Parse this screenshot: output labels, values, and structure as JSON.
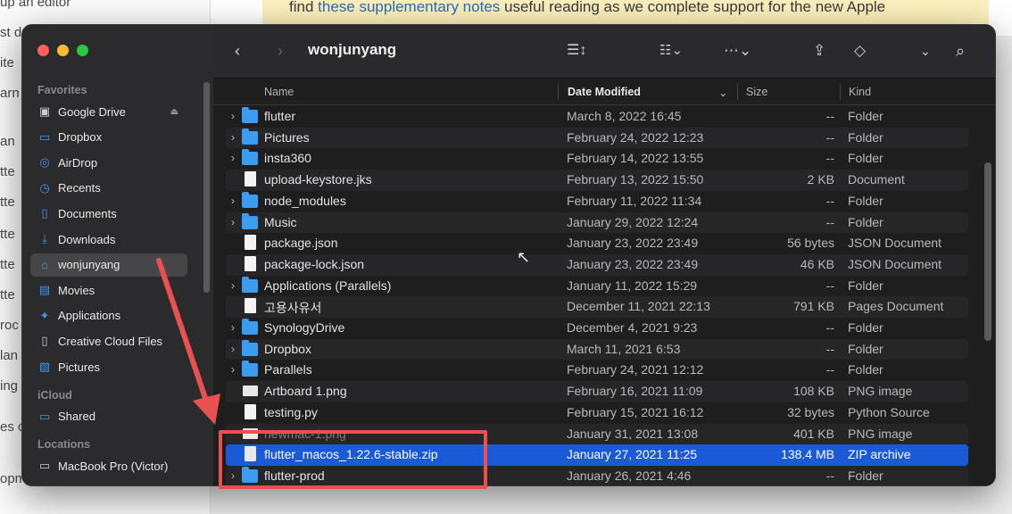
{
  "background": {
    "left_fragments": [
      "up an editor",
      "st d",
      "ite",
      "arn",
      "an",
      "tte",
      "tte",
      "tte",
      "tte",
      "tte",
      "roc",
      "lan",
      "ing",
      "es c",
      "opm"
    ],
    "note_prefix": "find ",
    "note_link": "these supplementary notes",
    "note_suffix": " useful reading as we complete support for the new Apple"
  },
  "window": {
    "title": "wonjunyang",
    "sidebar": {
      "sections": [
        {
          "label": "Favorites",
          "items": [
            {
              "label": "Google Drive",
              "icon": "drive-icon"
            },
            {
              "label": "Dropbox",
              "icon": "folder-icon"
            },
            {
              "label": "AirDrop",
              "icon": "airdrop-icon"
            },
            {
              "label": "Recents",
              "icon": "clock-icon"
            },
            {
              "label": "Documents",
              "icon": "document-icon"
            },
            {
              "label": "Downloads",
              "icon": "download-icon"
            },
            {
              "label": "wonjunyang",
              "icon": "home-icon",
              "selected": true
            },
            {
              "label": "Movies",
              "icon": "film-icon"
            },
            {
              "label": "Applications",
              "icon": "applications-icon"
            },
            {
              "label": "Creative Cloud Files",
              "icon": "file-icon"
            },
            {
              "label": "Pictures",
              "icon": "photo-icon"
            }
          ]
        },
        {
          "label": "iCloud",
          "items": [
            {
              "label": "Shared",
              "icon": "shared-folder-icon"
            }
          ]
        },
        {
          "label": "Locations",
          "items": [
            {
              "label": "MacBook Pro (Victor)",
              "icon": "laptop-icon"
            }
          ]
        }
      ]
    },
    "columns": {
      "name": "Name",
      "date": "Date Modified",
      "size": "Size",
      "kind": "Kind"
    },
    "files": [
      {
        "name": "flutter",
        "date": "March 8, 2022 16:45",
        "size": "--",
        "kind": "Folder",
        "type": "folder"
      },
      {
        "name": "Pictures",
        "date": "February 24, 2022 12:23",
        "size": "--",
        "kind": "Folder",
        "type": "folder"
      },
      {
        "name": "insta360",
        "date": "February 14, 2022 13:55",
        "size": "--",
        "kind": "Folder",
        "type": "folder"
      },
      {
        "name": "upload-keystore.jks",
        "date": "February 13, 2022 15:50",
        "size": "2 KB",
        "kind": "Document",
        "type": "doc"
      },
      {
        "name": "node_modules",
        "date": "February 11, 2022 11:34",
        "size": "--",
        "kind": "Folder",
        "type": "folder"
      },
      {
        "name": "Music",
        "date": "January 29, 2022 12:24",
        "size": "--",
        "kind": "Folder",
        "type": "folder"
      },
      {
        "name": "package.json",
        "date": "January 23, 2022 23:49",
        "size": "56 bytes",
        "kind": "JSON Document",
        "type": "doc"
      },
      {
        "name": "package-lock.json",
        "date": "January 23, 2022 23:49",
        "size": "46 KB",
        "kind": "JSON Document",
        "type": "doc"
      },
      {
        "name": "Applications (Parallels)",
        "date": "January 11, 2022 15:29",
        "size": "--",
        "kind": "Folder",
        "type": "folder"
      },
      {
        "name": "고용사유서",
        "date": "December 11, 2021 22:13",
        "size": "791 KB",
        "kind": "Pages Document",
        "type": "doc"
      },
      {
        "name": "SynologyDrive",
        "date": "December 4, 2021 9:23",
        "size": "--",
        "kind": "Folder",
        "type": "folder"
      },
      {
        "name": "Dropbox",
        "date": "March 11, 2021 6:53",
        "size": "--",
        "kind": "Folder",
        "type": "folder"
      },
      {
        "name": "Parallels",
        "date": "February 24, 2021 12:12",
        "size": "--",
        "kind": "Folder",
        "type": "folder"
      },
      {
        "name": "Artboard 1.png",
        "date": "February 16, 2021 11:09",
        "size": "108 KB",
        "kind": "PNG image",
        "type": "img"
      },
      {
        "name": "testing.py",
        "date": "February 15, 2021 16:12",
        "size": "32 bytes",
        "kind": "Python Source",
        "type": "doc"
      },
      {
        "name": "newmac-1.png",
        "date": "January 31, 2021 13:08",
        "size": "401 KB",
        "kind": "PNG image",
        "type": "img",
        "dim": true
      },
      {
        "name": "flutter_macos_1.22.6-stable.zip",
        "date": "January 27, 2021 11:25",
        "size": "138.4 MB",
        "kind": "ZIP archive",
        "type": "zip",
        "selected": true
      },
      {
        "name": "flutter-prod",
        "date": "January 26, 2021 4:46",
        "size": "--",
        "kind": "Folder",
        "type": "folder"
      }
    ]
  },
  "colors": {
    "accent": "#1a5ad6",
    "annotation": "#e8514d",
    "folder": "#3b9df2"
  }
}
